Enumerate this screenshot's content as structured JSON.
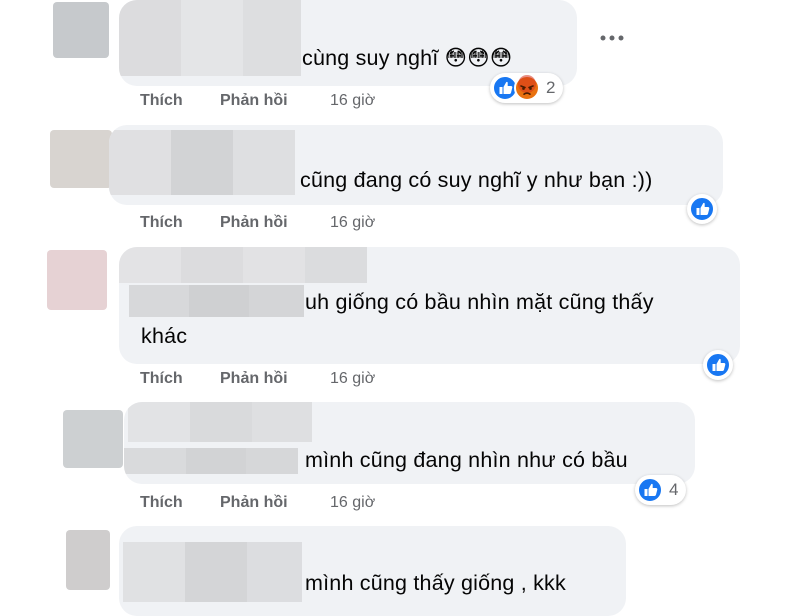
{
  "colors": {
    "bubble": "#f0f2f5",
    "action_text": "#65676b",
    "like_blue": "#1877f2",
    "angry_orange": "#e9710f"
  },
  "icons": [
    "like-icon",
    "angry-icon",
    "flushed-emoji-icon",
    "more-options-icon"
  ],
  "comments": [
    {
      "text_lines": [
        "cùng suy nghĩ 😳😳😳"
      ],
      "actions": {
        "like": "Thích",
        "reply": "Phản hồi",
        "time": "16 giờ"
      },
      "reactions": {
        "types": [
          "like",
          "angry"
        ],
        "count": "2"
      }
    },
    {
      "text_lines": [
        "cũng đang có suy nghĩ y như bạn :))"
      ],
      "actions": {
        "like": "Thích",
        "reply": "Phản hồi",
        "time": "16 giờ"
      },
      "reactions": {
        "types": [
          "like"
        ],
        "count": ""
      }
    },
    {
      "text_lines": [
        "uh giống có bầu nhìn mặt cũng thấy",
        "khác"
      ],
      "actions": {
        "like": "Thích",
        "reply": "Phản hồi",
        "time": "16 giờ"
      },
      "reactions": {
        "types": [
          "like"
        ],
        "count": ""
      }
    },
    {
      "text_lines": [
        "mình cũng đang nhìn như có bầu"
      ],
      "actions": {
        "like": "Thích",
        "reply": "Phản hồi",
        "time": "16 giờ"
      },
      "reactions": {
        "types": [
          "like"
        ],
        "count": "4"
      }
    },
    {
      "text_lines": [
        "mình cũng thấy giống , kkk"
      ],
      "actions": {},
      "reactions": {
        "types": [],
        "count": ""
      }
    }
  ]
}
